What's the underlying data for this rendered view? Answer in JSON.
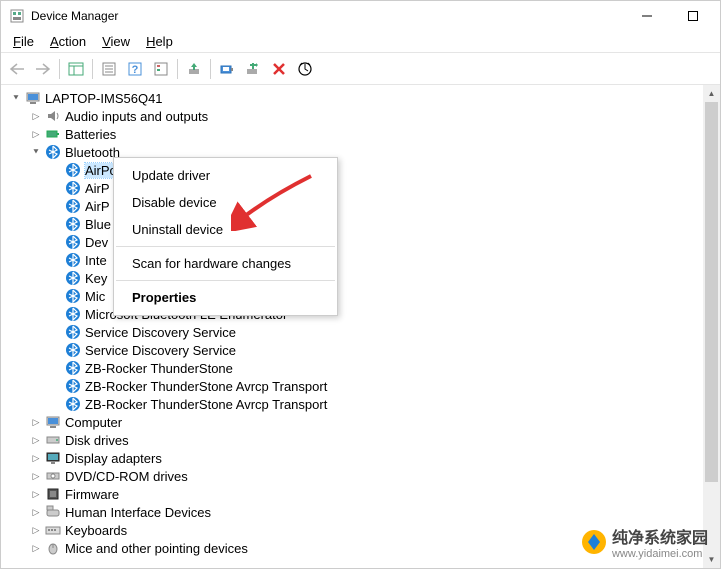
{
  "window": {
    "title": "Device Manager"
  },
  "menu": {
    "file": "File",
    "action": "Action",
    "view": "View",
    "help": "Help"
  },
  "tree": {
    "root": "LAPTOP-IMS56Q41",
    "audio": "Audio inputs and outputs",
    "batteries": "Batteries",
    "bluetooth": "Bluetooth",
    "bt_items": [
      "AirPods",
      "AirP",
      "AirP",
      "Blue",
      "Dev",
      "Inte",
      "Key",
      "Mic",
      "Microsoft Bluetooth LE Enumerator",
      "Service Discovery Service",
      "Service Discovery Service",
      "ZB-Rocker ThunderStone",
      "ZB-Rocker ThunderStone Avrcp Transport",
      "ZB-Rocker ThunderStone Avrcp Transport"
    ],
    "computer": "Computer",
    "disk": "Disk drives",
    "display": "Display adapters",
    "dvd": "DVD/CD-ROM drives",
    "firmware": "Firmware",
    "hid": "Human Interface Devices",
    "keyboards": "Keyboards",
    "mice": "Mice and other pointing devices"
  },
  "context_menu": {
    "update": "Update driver",
    "disable": "Disable device",
    "uninstall": "Uninstall device",
    "scan": "Scan for hardware changes",
    "properties": "Properties"
  },
  "watermark": {
    "title": "纯净系统家园",
    "url": "www.yidaimei.com"
  }
}
